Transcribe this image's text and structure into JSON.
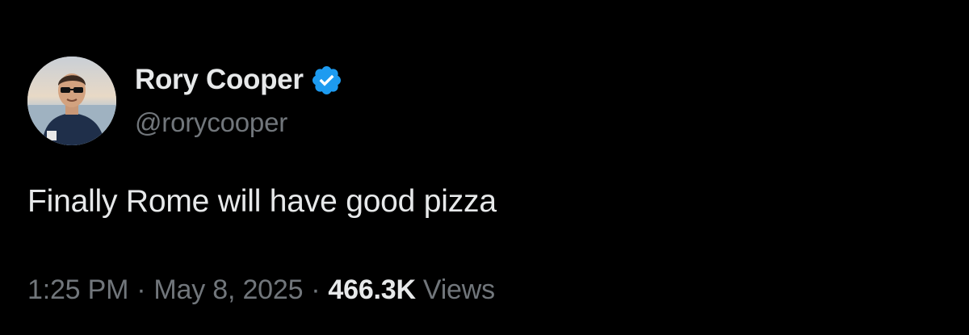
{
  "author": {
    "display_name": "Rory Cooper",
    "handle": "@rorycooper",
    "verified": true,
    "verified_color": "#1d9bf0",
    "avatar_icon": "profile-photo"
  },
  "tweet": {
    "text": "Finally Rome will have good pizza"
  },
  "meta": {
    "time": "1:25 PM",
    "separator": "·",
    "date": "May 8, 2025",
    "views_count": "466.3K",
    "views_label": "Views"
  },
  "colors": {
    "background": "#000000",
    "primary_text": "#e7e9ea",
    "secondary_text": "#71767b"
  }
}
